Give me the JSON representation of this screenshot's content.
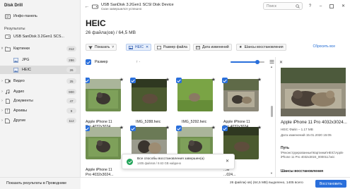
{
  "app": {
    "title": "Disk Drill"
  },
  "sidebar": {
    "item_info": "Инфо-панель",
    "section_title": "Результаты",
    "rows": [
      {
        "label": "USB SanDisk 3.2Gen1 SCS...",
        "count": "",
        "icon": "drive-icon",
        "level": 0,
        "chevron": ""
      },
      {
        "label": "Картинки",
        "count": "312",
        "icon": "folder-image-icon",
        "level": 0,
        "chevron": "v"
      },
      {
        "label": "JPG",
        "count": "286",
        "icon": "image-file-icon",
        "level": 1,
        "chevron": ""
      },
      {
        "label": "HEIC",
        "count": "26",
        "icon": "image-file-icon",
        "level": 1,
        "chevron": ""
      },
      {
        "label": "Видео",
        "count": "25",
        "icon": "video-icon",
        "level": 0,
        "chevron": ">"
      },
      {
        "label": "Аудио",
        "count": "900",
        "icon": "audio-icon",
        "level": 0,
        "chevron": ">"
      },
      {
        "label": "Документы",
        "count": "47",
        "icon": "document-icon",
        "level": 0,
        "chevron": ">"
      },
      {
        "label": "Архивы",
        "count": "9",
        "icon": "archive-icon",
        "level": 0,
        "chevron": ">"
      },
      {
        "label": "Другие",
        "count": "112",
        "icon": "other-icon",
        "level": 0,
        "chevron": ">"
      }
    ],
    "footer": "Показать результаты в Проводнике"
  },
  "titlebar": {
    "device": "USB SanDisk 3.2Gen1 SCSI Disk Device",
    "status": "Скан завершился успешно",
    "search_placeholder": "Поиск"
  },
  "main": {
    "title": "HEIC",
    "subtitle": "26 файла(ов) / 64,5 MB",
    "toolbar": {
      "show": "Показать",
      "heic_chip": "HEIC",
      "size_chip": "Размер файла",
      "date_chip": "Дата изменений",
      "chances_chip": "Шансы восстановления",
      "reset": "Сбросить все"
    },
    "sort_label": "Размер",
    "sort_arrows": "↑   ·",
    "zoom_level": 0.8,
    "tiles": [
      {
        "name_line1": "Apple iPhone 11",
        "name_line2": "Pro 4032x3024...",
        "row": 0,
        "col": 0,
        "scene": "cat-grass"
      },
      {
        "name_line1": "IMG_5288.heic",
        "name_line2": "",
        "row": 0,
        "col": 1,
        "scene": "dark-grass"
      },
      {
        "name_line1": "IMG_5292.heic",
        "name_line2": "",
        "row": 0,
        "col": 2,
        "scene": "green-grass"
      },
      {
        "name_line1": "Apple iPhone 11",
        "name_line2": "Pro 4032x3024...",
        "row": 0,
        "col": 3,
        "scene": "yard"
      },
      {
        "name_line1": "Apple iPhone 11",
        "name_line2": "Pro 4032x3024...",
        "row": 1,
        "col": 0,
        "scene": "cat-grass"
      },
      {
        "name_line1": "",
        "name_line2": "",
        "row": 1,
        "col": 1,
        "scene": "cats-close"
      },
      {
        "name_line1": "",
        "name_line2": "",
        "row": 1,
        "col": 2,
        "scene": "cat-grass"
      },
      {
        "name_line1": "...le",
        "name_line2": "...024...",
        "row": 1,
        "col": 3,
        "scene": "dark-grass"
      }
    ]
  },
  "toast": {
    "title": "Все способы восстановления завершен(а)",
    "subtitle": "1405 файлов / 8.63 GB найдено"
  },
  "preview": {
    "file_name": "Apple iPhone 11 Pro 4032x3024...",
    "meta1": "HEIC Файл – 1.17 MB",
    "meta2": "Дата изменений 15.01.2020 15:05",
    "path_label": "Путь",
    "path_value": "\\Реконструированные\\Картинки\\HEIC\\Apple iPhone 11 Pro 4032x3024_000011.heic",
    "chances_label": "Шансы восстановления"
  },
  "status": {
    "text": "26 файла(-ов) (64,5 MB) выделено, 1405 всего",
    "recover": "Восстановить"
  },
  "colors": {
    "accent": "#2a6fdb",
    "success": "#23a45a"
  }
}
